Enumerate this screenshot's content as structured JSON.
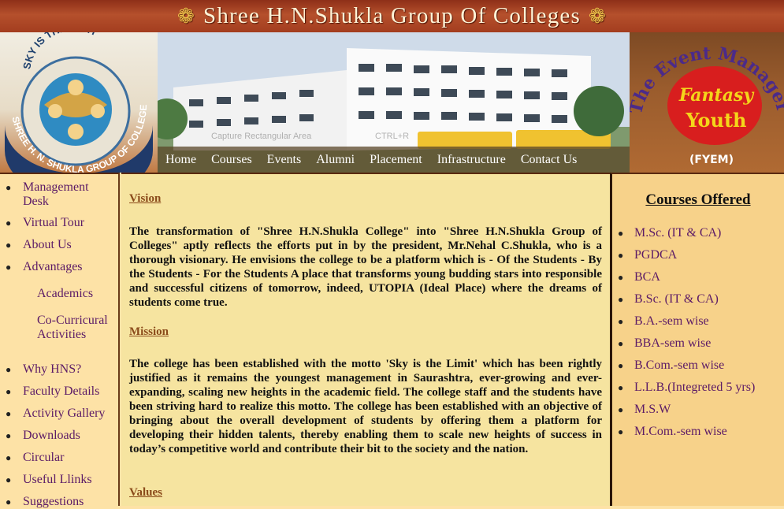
{
  "header": {
    "title": "Shree H.N.Shukla Group Of Colleges",
    "logo_left_text": "SHREE H. N. SHUKLA GROUP OF COLLEGES",
    "logo_left_motto": "SKY IS THE LIMIT",
    "logo_right_arc": "The Event Managers",
    "logo_right_line1": "Fantasy",
    "logo_right_line2": "Youth",
    "logo_right_abbr": "(FYEM)"
  },
  "nav": {
    "items": [
      "Home",
      "Courses",
      "Events",
      "Alumni",
      "Placement",
      "Infrastructure",
      "Contact Us"
    ]
  },
  "overlay": {
    "capture_hint": "Capture Rectangular Area",
    "shortcut_hint": "CTRL+R"
  },
  "sidebar": {
    "items": [
      {
        "label": "Management Desk"
      },
      {
        "label": "Virtual Tour"
      },
      {
        "label": "About Us"
      },
      {
        "label": "Advantages"
      },
      {
        "label": "Academics"
      },
      {
        "label": "Co-Curricural Activities"
      },
      {
        "label": "Why HNS?"
      },
      {
        "label": "Faculty Details"
      },
      {
        "label": "Activity Gallery"
      },
      {
        "label": "Downloads"
      },
      {
        "label": "Circular"
      },
      {
        "label": "Useful Llinks"
      },
      {
        "label": "Suggestions"
      }
    ]
  },
  "main": {
    "vision_heading": "Vision",
    "vision_text": "The transformation of \"Shree H.N.Shukla College\" into \"Shree H.N.Shukla Group of Colleges\" aptly reflects the efforts put in by the president, Mr.Nehal C.Shukla, who is a thorough visionary. He envisions the college to be a platform which is - Of the Students - By the Students - For the Students A place that transforms young budding stars into responsible and successful citizens of tomorrow, indeed, UTOPIA (Ideal Place) where the dreams of students come true.",
    "mission_heading": "Mission",
    "mission_text": "The college has been established with the motto 'Sky is the Limit' which has been rightly justified as it remains the youngest management in Saurashtra, ever-growing and ever-expanding, scaling new heights in the academic field. The college staff and the students have been striving hard to realize this motto. The college has been established with an objective of bringing about the overall development of students by offering them a platform for developing their hidden talents, thereby enabling them to scale new heights of success in today’s competitive world and contribute their bit to the society and the nation.",
    "values_heading": "Values"
  },
  "courses": {
    "title": "Courses Offered",
    "items": [
      {
        "label": "M.Sc. (IT & CA)"
      },
      {
        "label": "PGDCA"
      },
      {
        "label": "BCA"
      },
      {
        "label": "B.Sc. (IT & CA)"
      },
      {
        "label": "B.A.-sem wise"
      },
      {
        "label": "BBA-sem wise"
      },
      {
        "label": "B.Com.-sem wise"
      },
      {
        "label": "L.L.B.(Integreted 5 yrs)"
      },
      {
        "label": "M.S.W"
      },
      {
        "label": "M.Com.-sem wise"
      }
    ]
  },
  "colors": {
    "link": "#5b1a66",
    "heading": "#8a4a1a",
    "page_bg": "#fde2a6",
    "main_bg": "#f6e4a0",
    "header_bar": "#a33d1f"
  }
}
